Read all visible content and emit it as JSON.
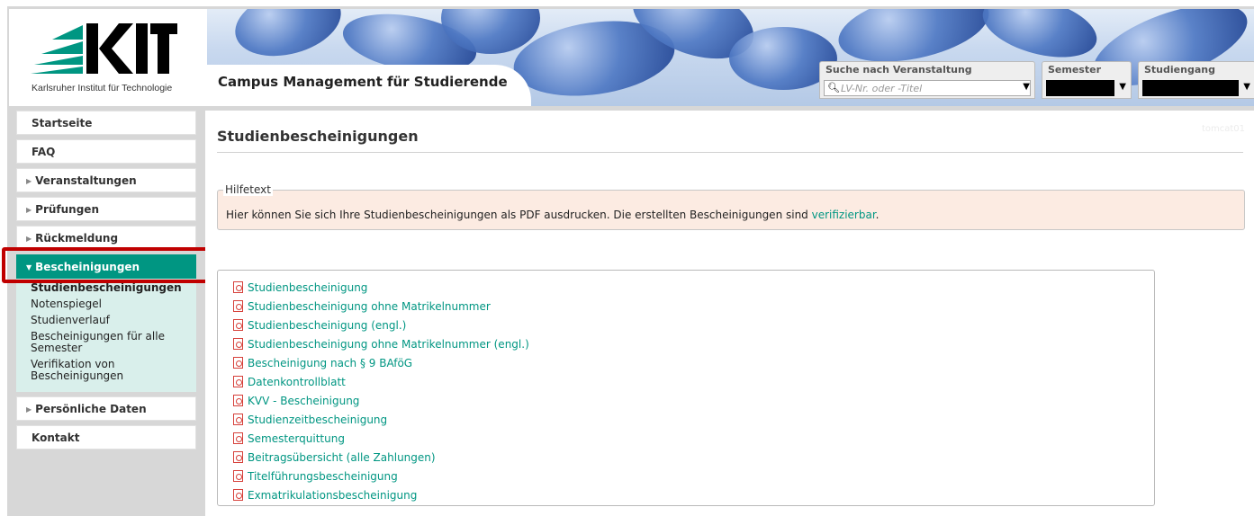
{
  "header": {
    "logo_subtitle": "Karlsruher Institut für Technologie",
    "app_title": "Campus Management für Studierende",
    "search": {
      "label": "Suche nach Veranstaltung",
      "placeholder": "LV-Nr. oder -Titel"
    },
    "semester": {
      "label": "Semester"
    },
    "studiengang": {
      "label": "Studiengang"
    }
  },
  "sidebar": {
    "items": [
      {
        "label": "Startseite"
      },
      {
        "label": "FAQ"
      },
      {
        "label": "Veranstaltungen"
      },
      {
        "label": "Prüfungen"
      },
      {
        "label": "Rückmeldung"
      },
      {
        "label": "Bescheinigungen"
      },
      {
        "label": "Persönliche Daten"
      },
      {
        "label": "Kontakt"
      }
    ],
    "subitems": [
      {
        "label": "Studienbescheinigungen"
      },
      {
        "label": "Notenspiegel"
      },
      {
        "label": "Studienverlauf"
      },
      {
        "label": "Bescheinigungen für alle Semester"
      },
      {
        "label": "Verifikation von Bescheinigungen"
      }
    ]
  },
  "main": {
    "server_tag": "tomcat01",
    "title": "Studienbescheinigungen",
    "help_legend": "Hilfetext",
    "help_text": "Hier können Sie sich Ihre Studienbescheinigungen als PDF ausdrucken. Die erstellten Bescheinigungen sind ",
    "help_link": "verifizierbar",
    "help_end": ".",
    "documents": [
      "Studienbescheinigung",
      "Studienbescheinigung ohne Matrikelnummer",
      "Studienbescheinigung (engl.)",
      "Studienbescheinigung ohne Matrikelnummer (engl.)",
      "Bescheinigung nach § 9 BAföG",
      "Datenkontrollblatt",
      "KVV - Bescheinigung",
      "Studienzeitbescheinigung",
      "Semesterquittung",
      "Beitragsübersicht (alle Zahlungen)",
      "Titelführungsbescheinigung",
      "Exmatrikulationsbescheinigung"
    ]
  },
  "colors": {
    "accent": "#009682",
    "highlight": "#c00000",
    "help_bg": "#fcebe2",
    "submenu_bg": "#d9efeb"
  }
}
